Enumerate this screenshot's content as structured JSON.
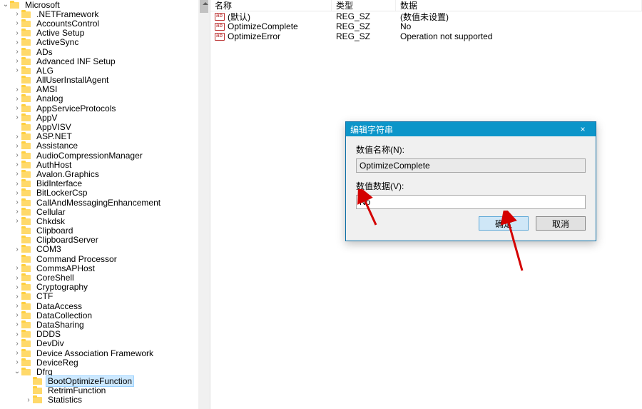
{
  "tree": {
    "root": {
      "label": "Microsoft",
      "expander": "expanded"
    },
    "items": [
      {
        "label": ".NETFramework",
        "expander": "collapsed",
        "indent": 1
      },
      {
        "label": "AccountsControl",
        "expander": "collapsed",
        "indent": 1
      },
      {
        "label": "Active Setup",
        "expander": "collapsed",
        "indent": 1
      },
      {
        "label": "ActiveSync",
        "expander": "collapsed",
        "indent": 1
      },
      {
        "label": "ADs",
        "expander": "collapsed",
        "indent": 1
      },
      {
        "label": "Advanced INF Setup",
        "expander": "collapsed",
        "indent": 1
      },
      {
        "label": "ALG",
        "expander": "collapsed",
        "indent": 1
      },
      {
        "label": "AllUserInstallAgent",
        "expander": "none",
        "indent": 1
      },
      {
        "label": "AMSI",
        "expander": "collapsed",
        "indent": 1
      },
      {
        "label": "Analog",
        "expander": "collapsed",
        "indent": 1
      },
      {
        "label": "AppServiceProtocols",
        "expander": "collapsed",
        "indent": 1
      },
      {
        "label": "AppV",
        "expander": "collapsed",
        "indent": 1
      },
      {
        "label": "AppVISV",
        "expander": "none",
        "indent": 1
      },
      {
        "label": "ASP.NET",
        "expander": "collapsed",
        "indent": 1
      },
      {
        "label": "Assistance",
        "expander": "collapsed",
        "indent": 1
      },
      {
        "label": "AudioCompressionManager",
        "expander": "collapsed",
        "indent": 1
      },
      {
        "label": "AuthHost",
        "expander": "collapsed",
        "indent": 1
      },
      {
        "label": "Avalon.Graphics",
        "expander": "collapsed",
        "indent": 1
      },
      {
        "label": "BidInterface",
        "expander": "collapsed",
        "indent": 1
      },
      {
        "label": "BitLockerCsp",
        "expander": "collapsed",
        "indent": 1
      },
      {
        "label": "CallAndMessagingEnhancement",
        "expander": "collapsed",
        "indent": 1
      },
      {
        "label": "Cellular",
        "expander": "collapsed",
        "indent": 1
      },
      {
        "label": "Chkdsk",
        "expander": "collapsed",
        "indent": 1
      },
      {
        "label": "Clipboard",
        "expander": "none",
        "indent": 1
      },
      {
        "label": "ClipboardServer",
        "expander": "none",
        "indent": 1
      },
      {
        "label": "COM3",
        "expander": "collapsed",
        "indent": 1
      },
      {
        "label": "Command Processor",
        "expander": "none",
        "indent": 1
      },
      {
        "label": "CommsAPHost",
        "expander": "collapsed",
        "indent": 1
      },
      {
        "label": "CoreShell",
        "expander": "collapsed",
        "indent": 1
      },
      {
        "label": "Cryptography",
        "expander": "collapsed",
        "indent": 1
      },
      {
        "label": "CTF",
        "expander": "collapsed",
        "indent": 1
      },
      {
        "label": "DataAccess",
        "expander": "collapsed",
        "indent": 1
      },
      {
        "label": "DataCollection",
        "expander": "collapsed",
        "indent": 1
      },
      {
        "label": "DataSharing",
        "expander": "collapsed",
        "indent": 1
      },
      {
        "label": "DDDS",
        "expander": "collapsed",
        "indent": 1
      },
      {
        "label": "DevDiv",
        "expander": "collapsed",
        "indent": 1
      },
      {
        "label": "Device Association Framework",
        "expander": "collapsed",
        "indent": 1
      },
      {
        "label": "DeviceReg",
        "expander": "collapsed",
        "indent": 1
      },
      {
        "label": "Dfrg",
        "expander": "expanded",
        "indent": 1
      },
      {
        "label": "BootOptimizeFunction",
        "expander": "none",
        "indent": 2,
        "selected": true
      },
      {
        "label": "RetrimFunction",
        "expander": "none",
        "indent": 2
      },
      {
        "label": "Statistics",
        "expander": "collapsed",
        "indent": 2
      }
    ]
  },
  "list": {
    "headers": {
      "name": "名称",
      "type": "类型",
      "data": "数据"
    },
    "rows": [
      {
        "name": "(默认)",
        "type": "REG_SZ",
        "data": "(数值未设置)"
      },
      {
        "name": "OptimizeComplete",
        "type": "REG_SZ",
        "data": "No"
      },
      {
        "name": "OptimizeError",
        "type": "REG_SZ",
        "data": "Operation not supported"
      }
    ]
  },
  "dialog": {
    "title": "编辑字符串",
    "name_label": "数值名称(N):",
    "name_value": "OptimizeComplete",
    "data_label": "数值数据(V):",
    "data_value": "No",
    "ok": "确定",
    "cancel": "取消",
    "close": "×"
  }
}
